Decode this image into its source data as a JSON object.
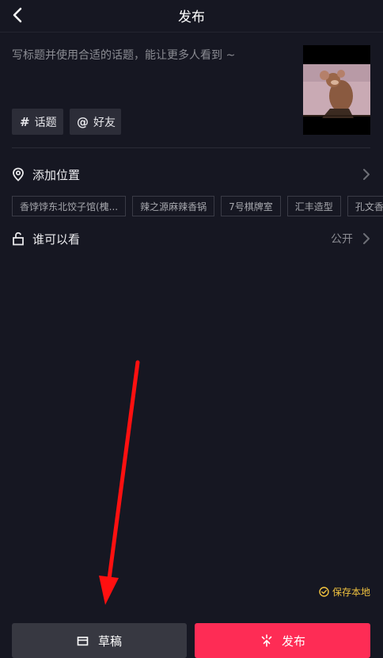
{
  "header": {
    "title": "发布",
    "back_icon": "chevron-left-icon"
  },
  "caption": {
    "placeholder": "写标题并使用合适的话题，能让更多人看到 ~"
  },
  "tags": {
    "topic_label": "话题",
    "topic_symbol": "#",
    "friends_label": "好友",
    "friends_symbol": "@"
  },
  "location": {
    "label": "添加位置",
    "icon": "location-pin-icon"
  },
  "location_suggestions": [
    "香饽饽东北饺子馆(槐...",
    "辣之源麻辣香锅",
    "7号棋牌室",
    "汇丰造型",
    "孔文香"
  ],
  "privacy": {
    "label": "谁可以看",
    "value": "公开",
    "icon": "unlock-icon"
  },
  "save_local": {
    "label": "保存本地",
    "checked": true
  },
  "actions": {
    "draft_label": "草稿",
    "publish_label": "发布"
  },
  "colors": {
    "background": "#161722",
    "accent": "#fe2c55",
    "save_local": "#f1c33f",
    "annotation_arrow": "#ff1010"
  }
}
